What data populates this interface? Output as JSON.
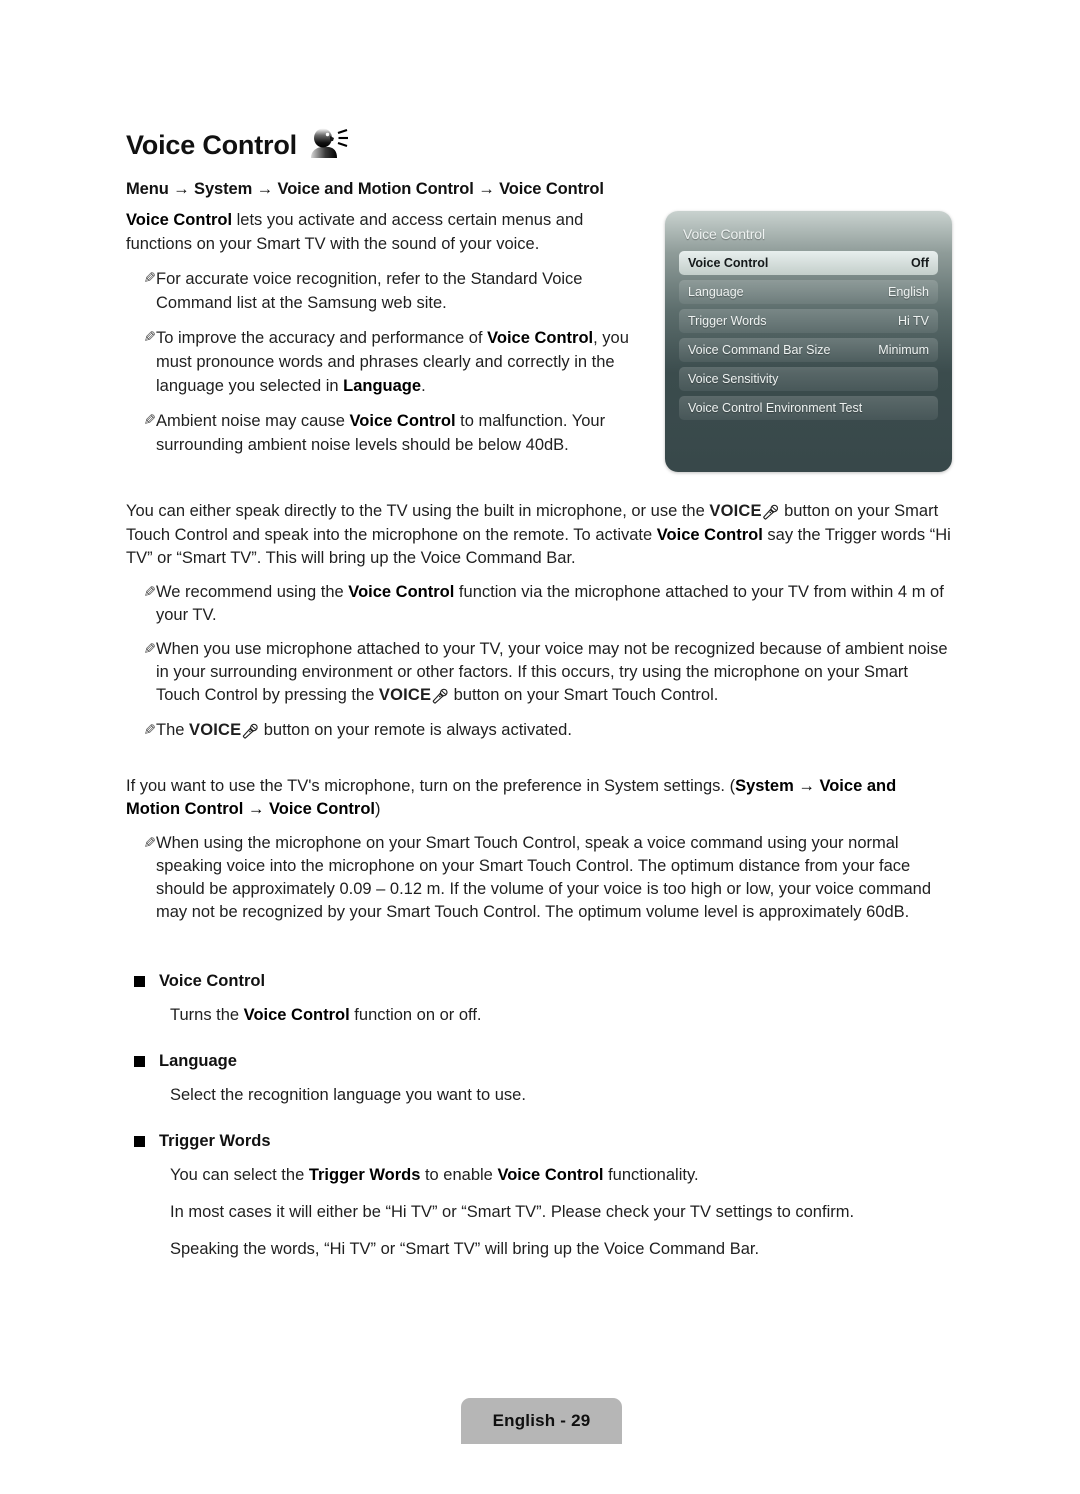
{
  "header": {
    "title": "Voice Control",
    "title_icon": "speaking-head-icon",
    "breadcrumb": "Menu → System → Voice and Motion Control → Voice Control"
  },
  "intro": {
    "lead_bold": "Voice Control",
    "lead_rest": " lets you activate and access certain menus and functions on your Smart TV with the sound of your voice.",
    "notes": [
      {
        "glyph": "note-pencil-icon",
        "parts": [
          {
            "text": "For accurate voice recognition, refer to the Standard Voice Command list at the Samsung web site.",
            "bold": false
          }
        ]
      },
      {
        "glyph": "note-pencil-icon",
        "parts": [
          {
            "text": "To improve the accuracy and performance of ",
            "bold": false
          },
          {
            "text": "Voice Control",
            "bold": true
          },
          {
            "text": ", you must pronounce words and phrases clearly and correctly in the language you selected in ",
            "bold": false
          },
          {
            "text": "Language",
            "bold": true
          },
          {
            "text": ".",
            "bold": false
          }
        ]
      },
      {
        "glyph": "note-pencil-icon",
        "parts": [
          {
            "text": "Ambient noise may cause ",
            "bold": false
          },
          {
            "text": "Voice Control",
            "bold": true
          },
          {
            "text": " to malfunction. Your surrounding ambient noise levels should be below 40dB.",
            "bold": false
          }
        ]
      }
    ]
  },
  "osd": {
    "panel_title": "Voice Control",
    "rows": [
      {
        "label": "Voice Control",
        "value": "Off",
        "selected": true
      },
      {
        "label": "Language",
        "value": "English",
        "selected": false
      },
      {
        "label": "Trigger Words",
        "value": "Hi TV",
        "selected": false
      },
      {
        "label": "Voice Command Bar Size",
        "value": "Minimum",
        "selected": false
      },
      {
        "label": "Voice Sensitivity",
        "value": "",
        "selected": false
      },
      {
        "label": "Voice Control Environment Test",
        "value": "",
        "selected": false
      }
    ]
  },
  "middle": {
    "paragraph": {
      "p1": "You can either speak directly to the TV using the built in microphone, or use the ",
      "voice_button": "VOICE",
      "mic_glyph": "microphone-icon",
      "p2": " button on your Smart Touch Control and speak into the microphone on the remote. To activate ",
      "bold1": "Voice Control",
      "p3": " say the Trigger words “Hi TV” or “Smart TV”. This will bring up the Voice Command Bar."
    },
    "notes": [
      {
        "glyph": "note-pencil-icon",
        "parts": [
          {
            "text": "We recommend using the ",
            "bold": false
          },
          {
            "text": "Voice Control",
            "bold": true
          },
          {
            "text": " function via the microphone attached to your TV from within 4 m of your TV.",
            "bold": false
          }
        ]
      },
      {
        "glyph": "note-pencil-icon",
        "parts": [
          {
            "text": "When you use microphone attached to your TV, your voice may not be recognized because of ambient noise in your surrounding environment or other factors. If this occurs, try using the microphone on your Smart Touch Control by pressing the ",
            "bold": false
          },
          {
            "text": "VOICE",
            "bold": true,
            "voice": true
          },
          {
            "text": " button on your Smart Touch Control.",
            "bold": false
          }
        ]
      },
      {
        "glyph": "note-pencil-icon",
        "parts": [
          {
            "text": "The ",
            "bold": false
          },
          {
            "text": "VOICE",
            "bold": true,
            "voice": true
          },
          {
            "text": " button on your remote is always activated.",
            "bold": false
          }
        ]
      }
    ]
  },
  "preference": {
    "paragraph": {
      "p1": "If you want to use the TV's microphone, turn on the preference in System settings. (",
      "bold1": "System → Voice and Motion Control → Voice Control",
      "p2": ")"
    },
    "note": {
      "glyph": "note-pencil-icon",
      "text": "When using the microphone on your Smart Touch Control, speak a voice command using your normal speaking voice into the microphone on your Smart Touch Control. The optimum distance from your face should be approximately 0.09 – 0.12 m. If the volume of your voice is too high or low, your voice command may not be recognized by your Smart Touch Control. The optimum volume level is approximately 60dB."
    }
  },
  "sections": [
    {
      "heading": "Voice Control",
      "paragraphs": [
        [
          {
            "text": "Turns the ",
            "bold": false
          },
          {
            "text": "Voice Control",
            "bold": true
          },
          {
            "text": " function on or off.",
            "bold": false
          }
        ]
      ]
    },
    {
      "heading": "Language",
      "paragraphs": [
        [
          {
            "text": "Select the recognition language you want to use.",
            "bold": false
          }
        ]
      ]
    },
    {
      "heading": "Trigger Words",
      "paragraphs": [
        [
          {
            "text": "You can select the ",
            "bold": false
          },
          {
            "text": "Trigger Words",
            "bold": true
          },
          {
            "text": " to enable ",
            "bold": false
          },
          {
            "text": "Voice Control",
            "bold": true
          },
          {
            "text": " functionality.",
            "bold": false
          }
        ],
        [
          {
            "text": "In most cases it will either be “Hi TV” or “Smart TV”. Please check your TV settings to confirm.",
            "bold": false
          }
        ],
        [
          {
            "text": "Speaking the words, “Hi TV” or “Smart TV” will bring up the Voice Command Bar.",
            "bold": false
          }
        ]
      ]
    }
  ],
  "footer": {
    "label": "English - 29"
  },
  "colors": {
    "page_background": "#ffffff",
    "text": "#1f1f1f",
    "osd_dark": "#38484a",
    "osd_row": "#5c6b6c",
    "osd_selected": "#dde5e3",
    "footer_tab": "#b6b6b6"
  }
}
